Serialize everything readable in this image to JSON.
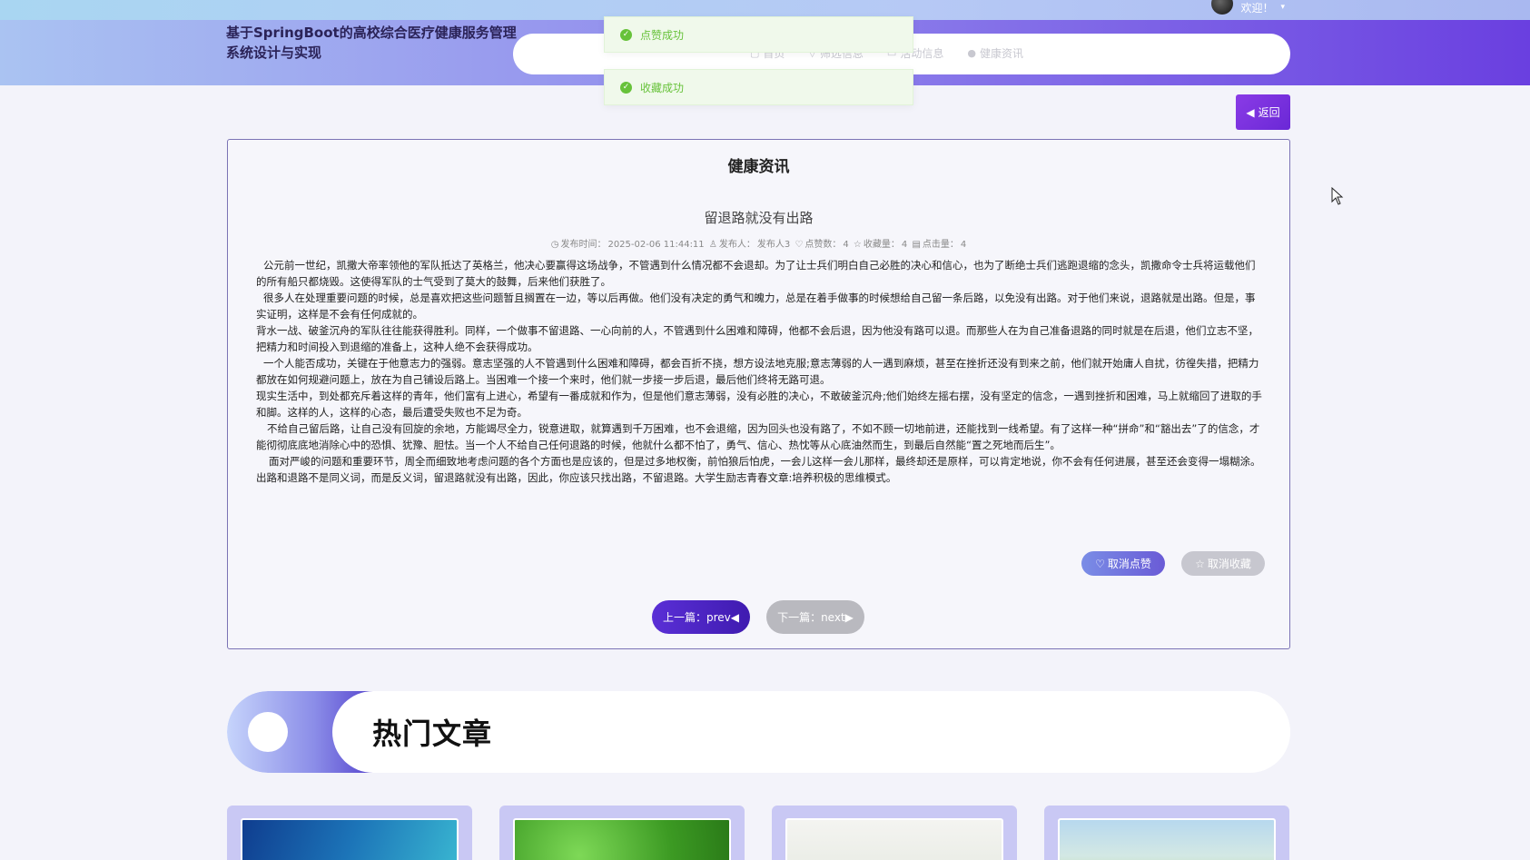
{
  "topbar": {
    "welcome_label": "欢迎！"
  },
  "header": {
    "site_title": "基于SpringBoot的高校综合医疗健康服务管理系统设计与实现",
    "nav": [
      {
        "label": "首页",
        "icon": "home-icon"
      },
      {
        "label": "筛选信息",
        "icon": "filter-icon"
      },
      {
        "label": "活动信息",
        "icon": "calendar-icon"
      },
      {
        "label": "健康资讯",
        "icon": "info-icon"
      }
    ]
  },
  "toasts": [
    {
      "message": "点赞成功",
      "icon": "check-circle-icon",
      "type": "success"
    },
    {
      "message": "收藏成功",
      "icon": "check-circle-icon",
      "type": "success"
    }
  ],
  "back_button": {
    "label": "返回",
    "icon": "caret-left-icon"
  },
  "article": {
    "section_title": "健康资讯",
    "title": "留退路就没有出路",
    "meta": {
      "publish_time_label": "发布时间：",
      "publish_time": "2025-02-06 11:44:11",
      "publisher_label": "发布人：",
      "publisher": "发布人3",
      "likes_label": "点赞数：",
      "likes": "4",
      "favorites_label": "收藏量：",
      "favorites": "4",
      "clicks_label": "点击量：",
      "clicks": "4"
    },
    "paragraphs": [
      "公元前一世纪，凯撒大帝率领他的军队抵达了英格兰，他决心要赢得这场战争，不管遇到什么情况都不会退却。为了让士兵们明白自己必胜的决心和信心，也为了断绝士兵们逃跑退缩的念头，凯撒命令士兵将运载他们的所有船只都烧毁。这使得军队的士气受到了莫大的鼓舞，后来他们获胜了。",
      "很多人在处理重要问题的时候，总是喜欢把这些问题暂且搁置在一边，等以后再做。他们没有决定的勇气和魄力，总是在着手做事的时候想给自己留一条后路，以免没有出路。对于他们来说，退路就是出路。但是，事实证明，这样是不会有任何成就的。",
      "背水一战、破釜沉舟的军队往往能获得胜利。同样，一个做事不留退路、一心向前的人，不管遇到什么困难和障碍，他都不会后退，因为他没有路可以退。而那些人在为自己准备退路的同时就是在后退，他们立志不坚，把精力和时间投入到退缩的准备上，这种人绝不会获得成功。",
      "一个人能否成功，关键在于他意志力的强弱。意志坚强的人不管遇到什么困难和障碍，都会百折不挠，想方设法地克服;意志薄弱的人一遇到麻烦，甚至在挫折还没有到来之前，他们就开始庸人自扰，彷徨失措，把精力都放在如何规避问题上，放在为自己铺设后路上。当困难一个接一个来时，他们就一步接一步后退，最后他们终将无路可退。",
      "现实生活中，到处都充斥着这样的青年，他们富有上进心，希望有一番成就和作为，但是他们意志薄弱，没有必胜的决心，不敢破釜沉舟;他们始终左摇右摆，没有坚定的信念，一遇到挫折和困难，马上就缩回了进取的手和脚。这样的人，这样的心态，最后遭受失败也不足为奇。",
      "不给自己留后路，让自己没有回旋的余地，方能竭尽全力，锐意进取，就算遇到千万困难，也不会退缩，因为回头也没有路了，不如不顾一切地前进，还能找到一线希望。有了这样一种“拼命”和“豁出去”了的信念，才能彻彻底底地消除心中的恐惧、犹豫、胆怯。当一个人不给自己任何退路的时候，他就什么都不怕了，勇气、信心、热忱等从心底油然而生，到最后自然能“置之死地而后生”。",
      "面对严峻的问题和重要环节，周全而细致地考虑问题的各个方面也是应该的，但是过多地权衡，前怕狼后怕虎，一会儿这样一会儿那样，最终却还是原样，可以肯定地说，你不会有任何进展，甚至还会变得一塌糊涂。",
      "出路和退路不是同义词，而是反义词，留退路就没有出路，因此，你应该只找出路，不留退路。大学生励志青春文章:培养积极的思维模式。"
    ],
    "like_button": "取消点赞",
    "favorite_button": "取消收藏",
    "prev_button": "上一篇：prev",
    "next_button": "下一篇：next"
  },
  "hot_section": {
    "title": "热门文章",
    "cards": [
      {
        "image": "blue-gradient-image"
      },
      {
        "image": "green-leaves-image"
      },
      {
        "image": "plant-sketch-image"
      },
      {
        "image": "landscape-image"
      }
    ]
  }
}
